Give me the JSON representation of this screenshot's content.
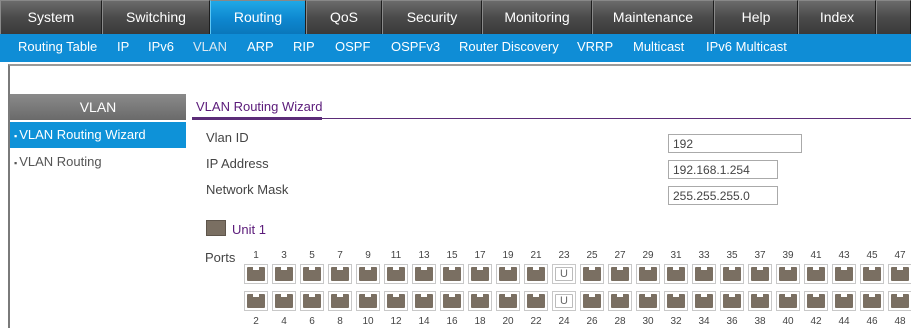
{
  "topnav": {
    "items": [
      {
        "label": "System"
      },
      {
        "label": "Switching"
      },
      {
        "label": "Routing"
      },
      {
        "label": "QoS"
      },
      {
        "label": "Security"
      },
      {
        "label": "Monitoring"
      },
      {
        "label": "Maintenance"
      },
      {
        "label": "Help"
      },
      {
        "label": "Index"
      }
    ],
    "active": "Routing"
  },
  "subnav": {
    "items": [
      {
        "label": "Routing Table"
      },
      {
        "label": "IP"
      },
      {
        "label": "IPv6"
      },
      {
        "label": "VLAN"
      },
      {
        "label": "ARP"
      },
      {
        "label": "RIP"
      },
      {
        "label": "OSPF"
      },
      {
        "label": "OSPFv3"
      },
      {
        "label": "Router Discovery"
      },
      {
        "label": "VRRP"
      },
      {
        "label": "Multicast"
      },
      {
        "label": "IPv6 Multicast"
      }
    ],
    "active": "VLAN"
  },
  "sidebar": {
    "header": "VLAN",
    "items": [
      {
        "label": "VLAN Routing Wizard"
      },
      {
        "label": "VLAN Routing"
      }
    ]
  },
  "content": {
    "title": "VLAN Routing Wizard",
    "fields": [
      {
        "label": "Vlan ID",
        "value": "192"
      },
      {
        "label": "IP Address",
        "value": "192.168.1.254"
      },
      {
        "label": "Network Mask",
        "value": "255.255.255.0"
      }
    ],
    "unit_label": "Unit 1",
    "ports_label": "Ports",
    "top_port_numbers": [
      "1",
      "3",
      "5",
      "7",
      "9",
      "11",
      "13",
      "15",
      "17",
      "19",
      "21",
      "23",
      "25",
      "27",
      "29",
      "31",
      "33",
      "35",
      "37",
      "39",
      "41",
      "43",
      "45",
      "47"
    ],
    "bottom_port_numbers": [
      "2",
      "4",
      "6",
      "8",
      "10",
      "12",
      "14",
      "16",
      "18",
      "20",
      "22",
      "24",
      "26",
      "28",
      "30",
      "32",
      "34",
      "36",
      "38",
      "40",
      "42",
      "44",
      "46",
      "48"
    ],
    "untagged_ports": [
      "23",
      "24"
    ],
    "untagged_marker": "U"
  },
  "colors": {
    "active_tab": "#0e87cf",
    "subnav_bg": "#0f8dd6",
    "title_color": "#5b1b7a",
    "port_color": "#7a6f62"
  }
}
